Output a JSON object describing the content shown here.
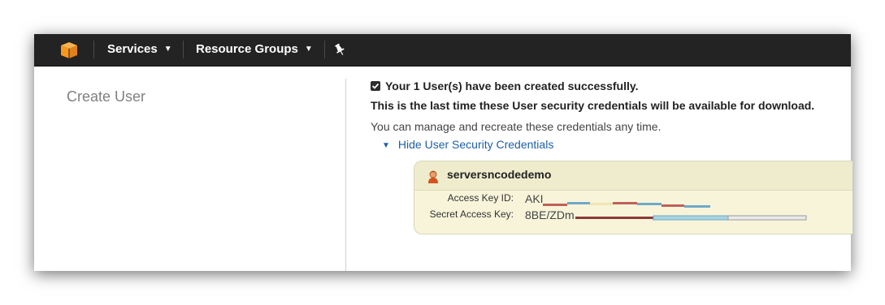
{
  "topbar": {
    "logo_icon": "aws-cube-icon",
    "nav_items": [
      {
        "label": "Services",
        "icon": "chevron-down-icon"
      },
      {
        "label": "Resource Groups",
        "icon": "chevron-down-icon"
      }
    ],
    "pin_icon": "pin-icon"
  },
  "sidebar": {
    "page_title": "Create User"
  },
  "main": {
    "success_message": "Your 1 User(s) have been created successfully.",
    "warning_message": "This is the last time these User security credentials will be available for download.",
    "manage_message": "You can manage and recreate these credentials any time.",
    "toggle_link": "Hide User Security Credentials",
    "credentials": {
      "user_name": "serversncodedemo",
      "access_key_label": "Access Key ID:",
      "access_key_value": "AKI",
      "secret_key_label": "Secret Access Key:",
      "secret_key_value": "8BE/ZDm"
    }
  },
  "colors": {
    "topbar_bg": "#232323",
    "logo_orange": "#f7981d",
    "link_blue": "#1e5fa8",
    "credentials_bg": "#f7f4da"
  }
}
